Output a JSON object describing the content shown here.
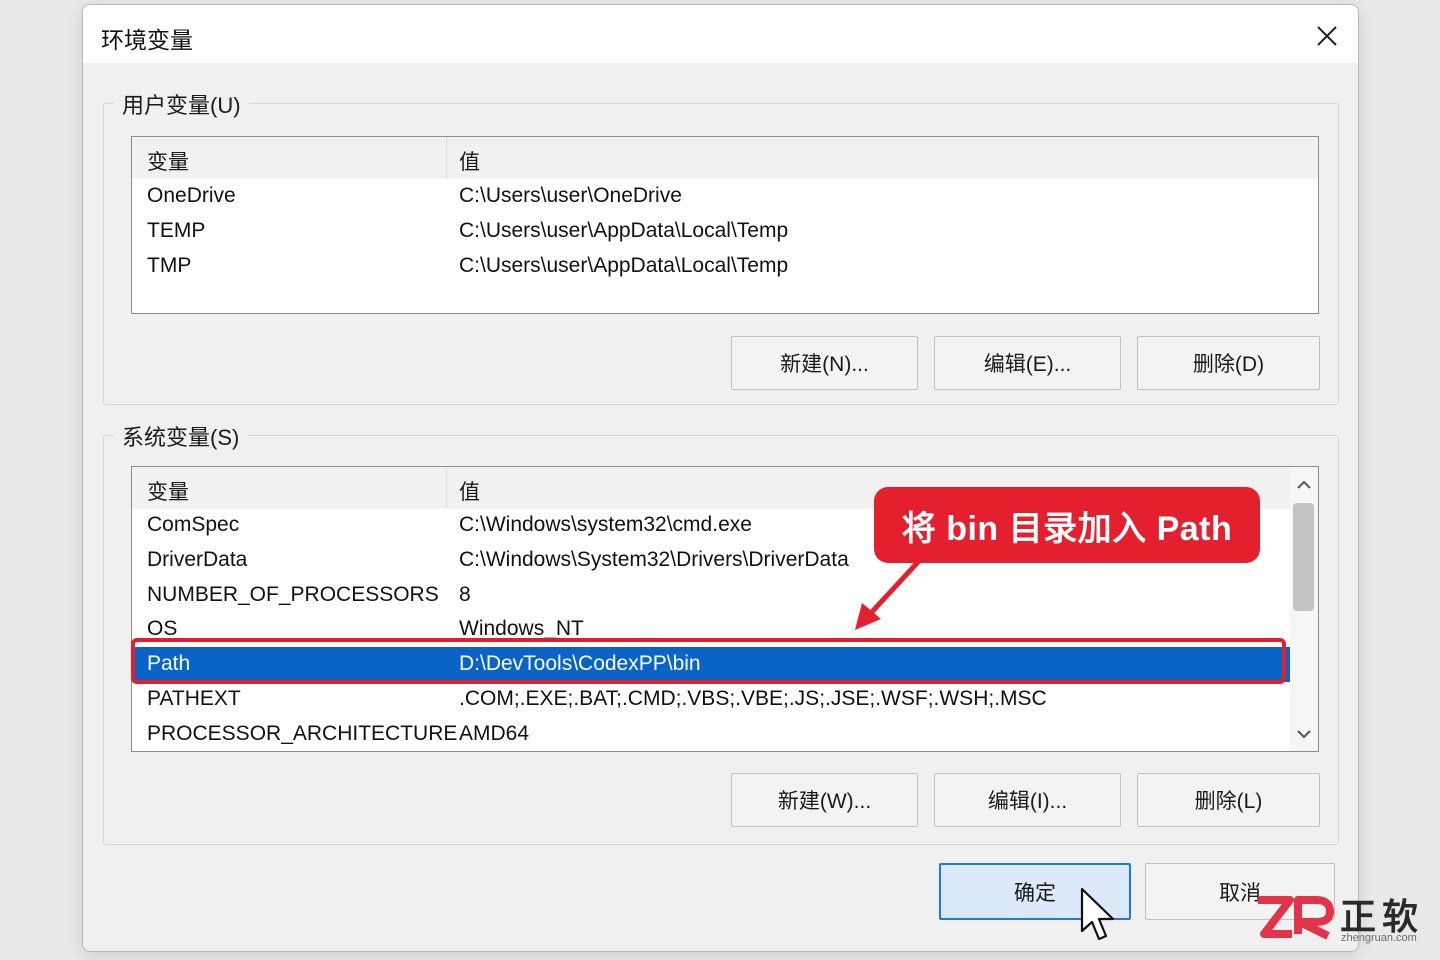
{
  "window": {
    "title": "环境变量",
    "close_glyph": "✕"
  },
  "user_vars": {
    "legend": "用户变量(U)",
    "header": {
      "name": "变量",
      "value": "值"
    },
    "rows": [
      {
        "name": "OneDrive",
        "value": "C:\\Users\\user\\OneDrive"
      },
      {
        "name": "TEMP",
        "value": "C:\\Users\\user\\AppData\\Local\\Temp"
      },
      {
        "name": "TMP",
        "value": "C:\\Users\\user\\AppData\\Local\\Temp"
      }
    ],
    "buttons": {
      "new": "新建(N)...",
      "edit": "编辑(E)...",
      "delete": "删除(D)"
    }
  },
  "system_vars": {
    "legend": "系统变量(S)",
    "header": {
      "name": "变量",
      "value": "值"
    },
    "rows": [
      {
        "name": "ComSpec",
        "value": "C:\\Windows\\system32\\cmd.exe"
      },
      {
        "name": "DriverData",
        "value": "C:\\Windows\\System32\\Drivers\\DriverData"
      },
      {
        "name": "NUMBER_OF_PROCESSORS",
        "value": "8"
      },
      {
        "name": "OS",
        "value": "Windows_NT"
      },
      {
        "name": "Path",
        "value": "D:\\DevTools\\CodexPP\\bin",
        "selected": true
      },
      {
        "name": "PATHEXT",
        "value": ".COM;.EXE;.BAT;.CMD;.VBS;.VBE;.JS;.JSE;.WSF;.WSH;.MSC"
      },
      {
        "name": "PROCESSOR_ARCHITECTURE",
        "value": "AMD64"
      }
    ],
    "buttons": {
      "new": "新建(W)...",
      "edit": "编辑(I)...",
      "delete": "删除(L)"
    }
  },
  "footer": {
    "ok": "确定",
    "cancel": "取消"
  },
  "annotation": {
    "callout_text": "将 bin 目录加入 Path",
    "color": "#e4202e"
  },
  "watermark": {
    "logo_letters": "ZR",
    "brand_cn": "正软",
    "url": "zhengruan.com"
  },
  "colors": {
    "selection": "#0a64c8",
    "primary_button": "#dbe9f8",
    "primary_border": "#1e7ad9"
  },
  "icons": {
    "close": "close-icon",
    "scroll_up": "chevron-up-icon",
    "scroll_down": "chevron-down-icon",
    "cursor": "mouse-pointer-icon"
  }
}
